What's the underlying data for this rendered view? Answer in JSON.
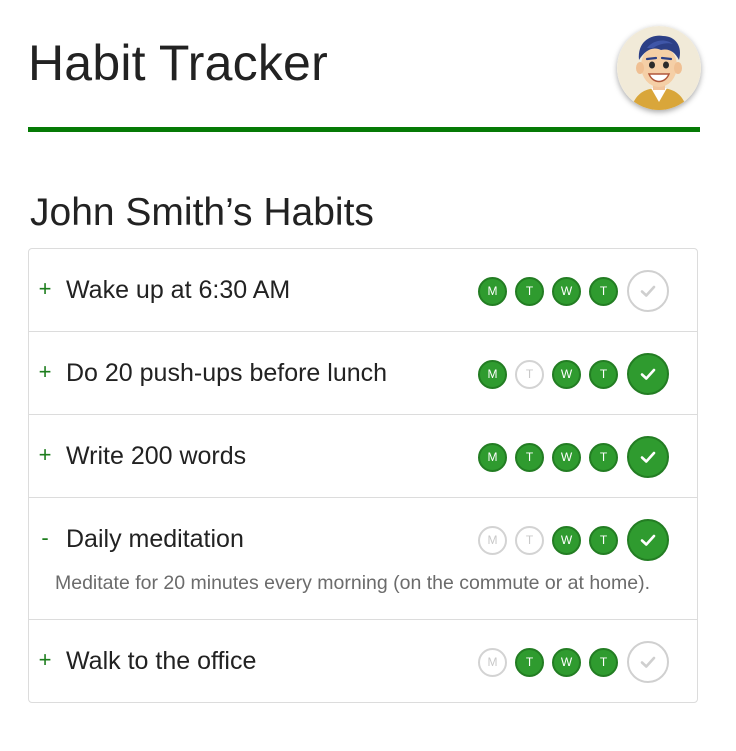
{
  "header": {
    "app_title": "Habit Tracker",
    "accent_color": "#057a05"
  },
  "section": {
    "title": "John Smith’s Habits"
  },
  "habits": [
    {
      "toggle": "+",
      "name": "Wake up at 6:30 AM",
      "expanded": false,
      "days": [
        {
          "label": "M",
          "done": true
        },
        {
          "label": "T",
          "done": true
        },
        {
          "label": "W",
          "done": true
        },
        {
          "label": "T",
          "done": true
        }
      ],
      "today_done": false
    },
    {
      "toggle": "+",
      "name": "Do 20 push-ups before lunch",
      "expanded": false,
      "days": [
        {
          "label": "M",
          "done": true
        },
        {
          "label": "T",
          "done": false
        },
        {
          "label": "W",
          "done": true
        },
        {
          "label": "T",
          "done": true
        }
      ],
      "today_done": true
    },
    {
      "toggle": "+",
      "name": "Write 200 words",
      "expanded": false,
      "days": [
        {
          "label": "M",
          "done": true
        },
        {
          "label": "T",
          "done": true
        },
        {
          "label": "W",
          "done": true
        },
        {
          "label": "T",
          "done": true
        }
      ],
      "today_done": true
    },
    {
      "toggle": "-",
      "name": "Daily meditation",
      "expanded": true,
      "description": "Meditate for 20 minutes every morning (on the commute or at home).",
      "days": [
        {
          "label": "M",
          "done": false
        },
        {
          "label": "T",
          "done": false
        },
        {
          "label": "W",
          "done": true
        },
        {
          "label": "T",
          "done": true
        }
      ],
      "today_done": true
    },
    {
      "toggle": "+",
      "name": "Walk to the office",
      "expanded": false,
      "days": [
        {
          "label": "M",
          "done": false
        },
        {
          "label": "T",
          "done": true
        },
        {
          "label": "W",
          "done": true
        },
        {
          "label": "T",
          "done": true
        }
      ],
      "today_done": false
    }
  ],
  "icons": {
    "avatar": "user-avatar-icon",
    "check": "checkmark-icon"
  },
  "colors": {
    "done_fill": "#2f9b2f",
    "missed_border": "#d3d3d3",
    "text_muted": "#6b6b6b"
  }
}
